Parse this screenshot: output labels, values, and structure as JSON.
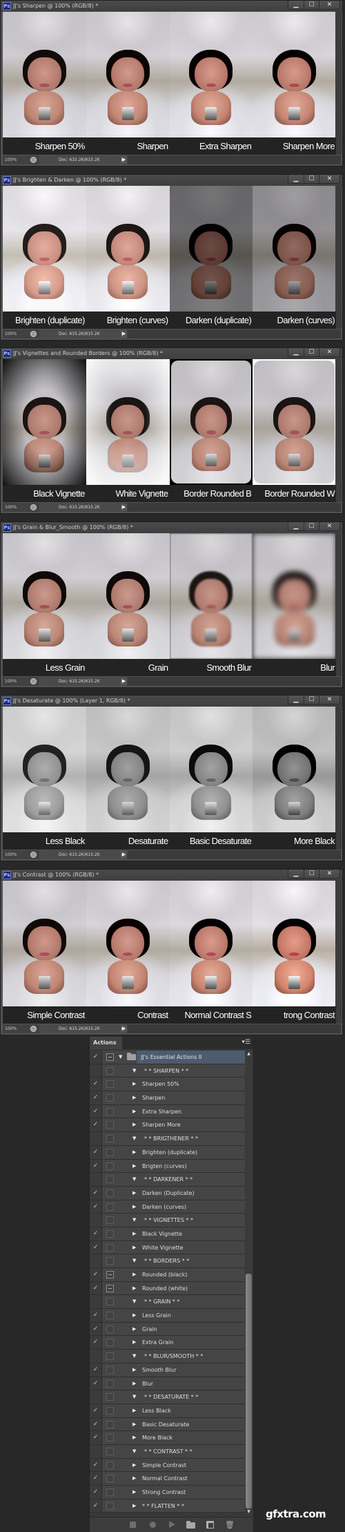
{
  "app": "Adobe Photoshop",
  "window_controls": {
    "minimize": "▁",
    "maximize": "☐",
    "close": "✕"
  },
  "windows": [
    {
      "title": "JJ's Sharpen @ 100% (RGB/8) *",
      "zoom": "100%",
      "doc": "Doc: 615.2K/615.2K",
      "panels": [
        {
          "caption": "Sharpen 50%",
          "variant": "v-sharp"
        },
        {
          "caption": "Sharpen",
          "variant": "v-sharp2"
        },
        {
          "caption": "Extra Sharpen",
          "variant": "v-sharp3"
        },
        {
          "caption": "Sharpen More",
          "variant": "v-sharp3"
        }
      ]
    },
    {
      "title": "JJ's Brighten & Darken @ 100% (RGB/8) *",
      "zoom": "100%",
      "doc": "Doc: 615.2K/615.2K",
      "panels": [
        {
          "caption": "Brighten (duplicate)",
          "variant": "v-bright"
        },
        {
          "caption": "Brighten (curves)",
          "variant": "v-bright-curves"
        },
        {
          "caption": "Darken (duplicate)",
          "variant": "v-dark"
        },
        {
          "caption": "Darken (curves)",
          "variant": "v-dark-curves"
        }
      ]
    },
    {
      "title": "JJ's Vignettes and Rounded Borders @ 100% (RGB/8) *",
      "zoom": "100%",
      "doc": "Doc: 615.2K/615.2K",
      "panels": [
        {
          "caption": "Black Vignette",
          "variant": "v-black-vignette"
        },
        {
          "caption": "White Vignette",
          "variant": "v-white-vignette"
        },
        {
          "caption": "Border Rounded B",
          "variant": "v-rounded-black"
        },
        {
          "caption": "Border Rounded W",
          "variant": "v-rounded-white"
        }
      ]
    },
    {
      "title": "JJ's Grain & Blur_Smooth @ 100% (RGB/8) *",
      "zoom": "100%",
      "doc": "Doc: 615.2K/615.2K",
      "panels": [
        {
          "caption": "Less Grain",
          "variant": "v-grain"
        },
        {
          "caption": "Grain",
          "variant": "v-grain"
        },
        {
          "caption": "Smooth Blur",
          "variant": "v-smooth-blur"
        },
        {
          "caption": "Blur",
          "variant": "v-blur"
        }
      ]
    },
    {
      "title": "JJ's Desaturate @ 100% (Layer 1, RGB/8) *",
      "zoom": "100%",
      "doc": "Doc: 615.2K/615.2K",
      "panels": [
        {
          "caption": "Less Black",
          "variant": "v-desat-less"
        },
        {
          "caption": "Desaturate",
          "variant": "v-desat"
        },
        {
          "caption": "Basic Desaturate",
          "variant": "v-desat-basic"
        },
        {
          "caption": "More Black",
          "variant": "v-desat-more"
        }
      ]
    },
    {
      "title": "JJ's Contrast @ 100% (RGB/8) *",
      "zoom": "100%",
      "doc": "Doc: 615.2K/615.2K",
      "panels": [
        {
          "caption": "Simple Contrast",
          "variant": "v-contrast-simple"
        },
        {
          "caption": "Contrast",
          "variant": "v-contrast"
        },
        {
          "caption": "Normal Contrast S",
          "variant": "v-contrast-normal"
        },
        {
          "caption": "trong Contrast",
          "variant": "v-contrast-strong"
        }
      ]
    }
  ],
  "actions_panel": {
    "tab_label": "Actions",
    "menu_icon": "▾☰",
    "scroll_position_fraction": 1.0,
    "scroll_visible_fraction": 0.52,
    "rows": [
      {
        "type": "set",
        "label": "JJ's Essential Actions II",
        "checked": true,
        "dialog": true,
        "expanded": true
      },
      {
        "type": "header",
        "label": "* * SHARPEN * *",
        "checked": false,
        "dialog": false,
        "expanded": true
      },
      {
        "type": "action",
        "label": "Sharpen 50%",
        "checked": true,
        "dialog": false
      },
      {
        "type": "action",
        "label": "Sharpen",
        "checked": true,
        "dialog": false
      },
      {
        "type": "action",
        "label": "Extra Sharpen",
        "checked": true,
        "dialog": false
      },
      {
        "type": "action",
        "label": "Sharpen More",
        "checked": true,
        "dialog": false
      },
      {
        "type": "header",
        "label": "* * BRIGTHENER * *",
        "checked": false,
        "dialog": false,
        "expanded": true
      },
      {
        "type": "action",
        "label": "Brighten (duplicate)",
        "checked": true,
        "dialog": false
      },
      {
        "type": "action",
        "label": "Brigten (curves)",
        "checked": true,
        "dialog": false
      },
      {
        "type": "header",
        "label": "* * DARKENER * *",
        "checked": false,
        "dialog": false,
        "expanded": true
      },
      {
        "type": "action",
        "label": "Darken (Duplicate)",
        "checked": true,
        "dialog": false
      },
      {
        "type": "action",
        "label": "Darken (curves)",
        "checked": true,
        "dialog": false
      },
      {
        "type": "header",
        "label": "* *  VIGNETTES * *",
        "checked": false,
        "dialog": false,
        "expanded": true
      },
      {
        "type": "action",
        "label": "Black Vignette",
        "checked": true,
        "dialog": false
      },
      {
        "type": "action",
        "label": "White Vignette",
        "checked": true,
        "dialog": false
      },
      {
        "type": "header",
        "label": "* * BORDERS * *",
        "checked": false,
        "dialog": false,
        "expanded": true
      },
      {
        "type": "action",
        "label": "Rounded (black)",
        "checked": true,
        "dialog": true
      },
      {
        "type": "action",
        "label": "Rounded (white)",
        "checked": true,
        "dialog": true
      },
      {
        "type": "header",
        "label": "* * GRAIN * *",
        "checked": false,
        "dialog": false,
        "expanded": true
      },
      {
        "type": "action",
        "label": "Less Grain",
        "checked": true,
        "dialog": false
      },
      {
        "type": "action",
        "label": "Grain",
        "checked": true,
        "dialog": false
      },
      {
        "type": "action",
        "label": "Extra Grain",
        "checked": true,
        "dialog": false
      },
      {
        "type": "header",
        "label": "* * BLUR/SMOOTH * *",
        "checked": false,
        "dialog": false,
        "expanded": true
      },
      {
        "type": "action",
        "label": "Smooth Blur",
        "checked": true,
        "dialog": false
      },
      {
        "type": "action",
        "label": "Blur",
        "checked": true,
        "dialog": false
      },
      {
        "type": "header",
        "label": "* * DESATURATE * *",
        "checked": false,
        "dialog": false,
        "expanded": true
      },
      {
        "type": "action",
        "label": "Less Black",
        "checked": true,
        "dialog": false
      },
      {
        "type": "action",
        "label": "Basic Desaturate",
        "checked": true,
        "dialog": false
      },
      {
        "type": "action",
        "label": "More Black",
        "checked": true,
        "dialog": false
      },
      {
        "type": "header",
        "label": "* * CONTRAST * *",
        "checked": false,
        "dialog": false,
        "expanded": true
      },
      {
        "type": "action",
        "label": "Simple Contrast",
        "checked": true,
        "dialog": false
      },
      {
        "type": "action",
        "label": "Normal Contrast",
        "checked": true,
        "dialog": false
      },
      {
        "type": "action",
        "label": "Strong Contrast",
        "checked": true,
        "dialog": false
      },
      {
        "type": "action",
        "label": "* * FLATTEN * *",
        "checked": true,
        "dialog": false
      }
    ],
    "toolbar": [
      {
        "name": "stop-playing-button",
        "cls": "stop",
        "glyph": ""
      },
      {
        "name": "record-button",
        "cls": "rec",
        "glyph": ""
      },
      {
        "name": "play-selection-button",
        "cls": "play",
        "glyph": ""
      },
      {
        "name": "new-set-button",
        "cls": "newset",
        "glyph": ""
      },
      {
        "name": "new-action-button",
        "cls": "newact",
        "glyph": ""
      },
      {
        "name": "delete-button",
        "cls": "trash",
        "glyph": "🗑"
      }
    ]
  },
  "watermark": "gfxtra.com",
  "colors": {
    "workspace": "#282828",
    "window_chrome": "#535353",
    "caption_band": "#232323",
    "selected_set": "#4d5b6e",
    "ps_icon": "#1c2a6e"
  }
}
